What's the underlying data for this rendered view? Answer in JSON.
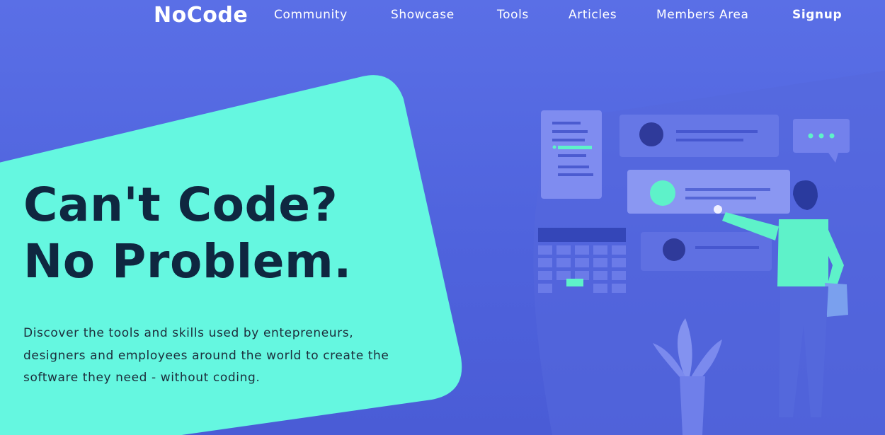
{
  "nav": {
    "brand": "NoCode",
    "links": [
      "Community",
      "Showcase",
      "Tools",
      "Articles",
      "Members Area"
    ],
    "signup": "Signup"
  },
  "hero": {
    "title_line1": "Can't Code?",
    "title_line2": "No Problem.",
    "description": "Discover the tools and skills used by entepreneurs, designers and employees around the world to create the software they need - without coding."
  },
  "colors": {
    "background": "#5a6fe6",
    "card": "#65f7e0",
    "title": "#0f2740",
    "accent": "#5ef2c9"
  }
}
